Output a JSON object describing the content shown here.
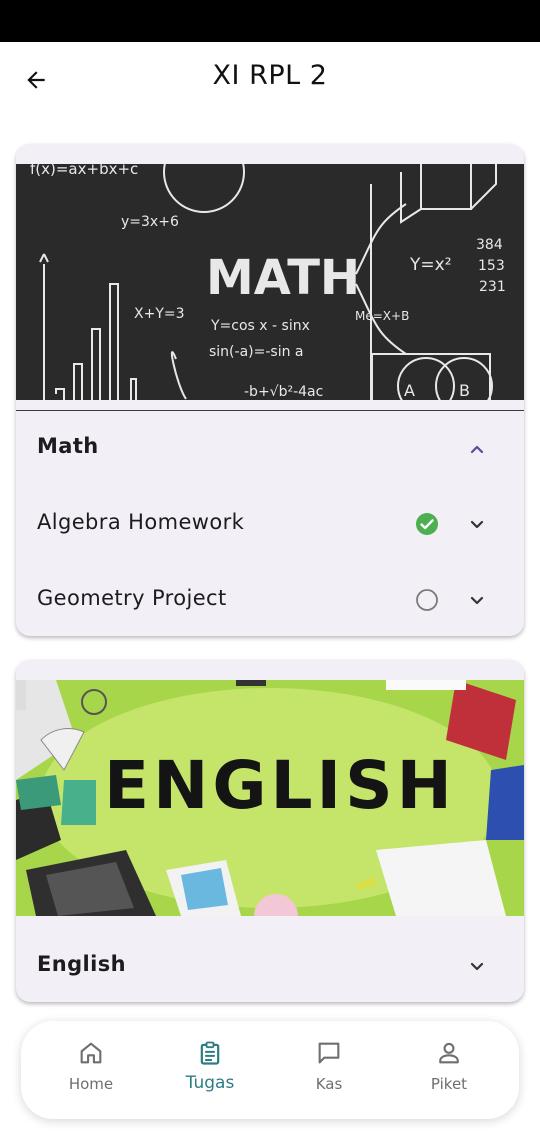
{
  "app_bar": {
    "title": "XI RPL 2"
  },
  "subjects": [
    {
      "name": "Math",
      "banner_text": "MATH",
      "banner_formulas": [
        "f(x)=ax+bx+c",
        "y=3x+6",
        "X+Y=3",
        "Y=cos x - sinx",
        "sin(-a)=-sin a",
        "Y=x²",
        "Me=X+B",
        "384",
        "153",
        "231",
        "-b+√b²-4ac",
        "A",
        "B"
      ],
      "expanded": true,
      "tasks": [
        {
          "name": "Algebra Homework",
          "status": "completed",
          "status_icon": "check-circle-icon"
        },
        {
          "name": "Geometry Project",
          "status": "not-completed",
          "status_icon": "empty-circle-icon"
        }
      ]
    },
    {
      "name": "English",
      "banner_text": "ENGLISH",
      "expanded": false,
      "tasks": []
    }
  ],
  "bottom_nav": {
    "items": [
      {
        "label": "Home",
        "icon": "home-icon",
        "active": false
      },
      {
        "label": "Tugas",
        "icon": "clipboard-icon",
        "active": true
      },
      {
        "label": "Kas",
        "icon": "chat-icon",
        "active": false
      },
      {
        "label": "Piket",
        "icon": "person-icon",
        "active": false
      }
    ]
  },
  "colors": {
    "accent": "#2d7d84",
    "card_bg": "#f3eff7",
    "check_green": "#4caf50",
    "chevron_purple": "#5b4a9a"
  }
}
